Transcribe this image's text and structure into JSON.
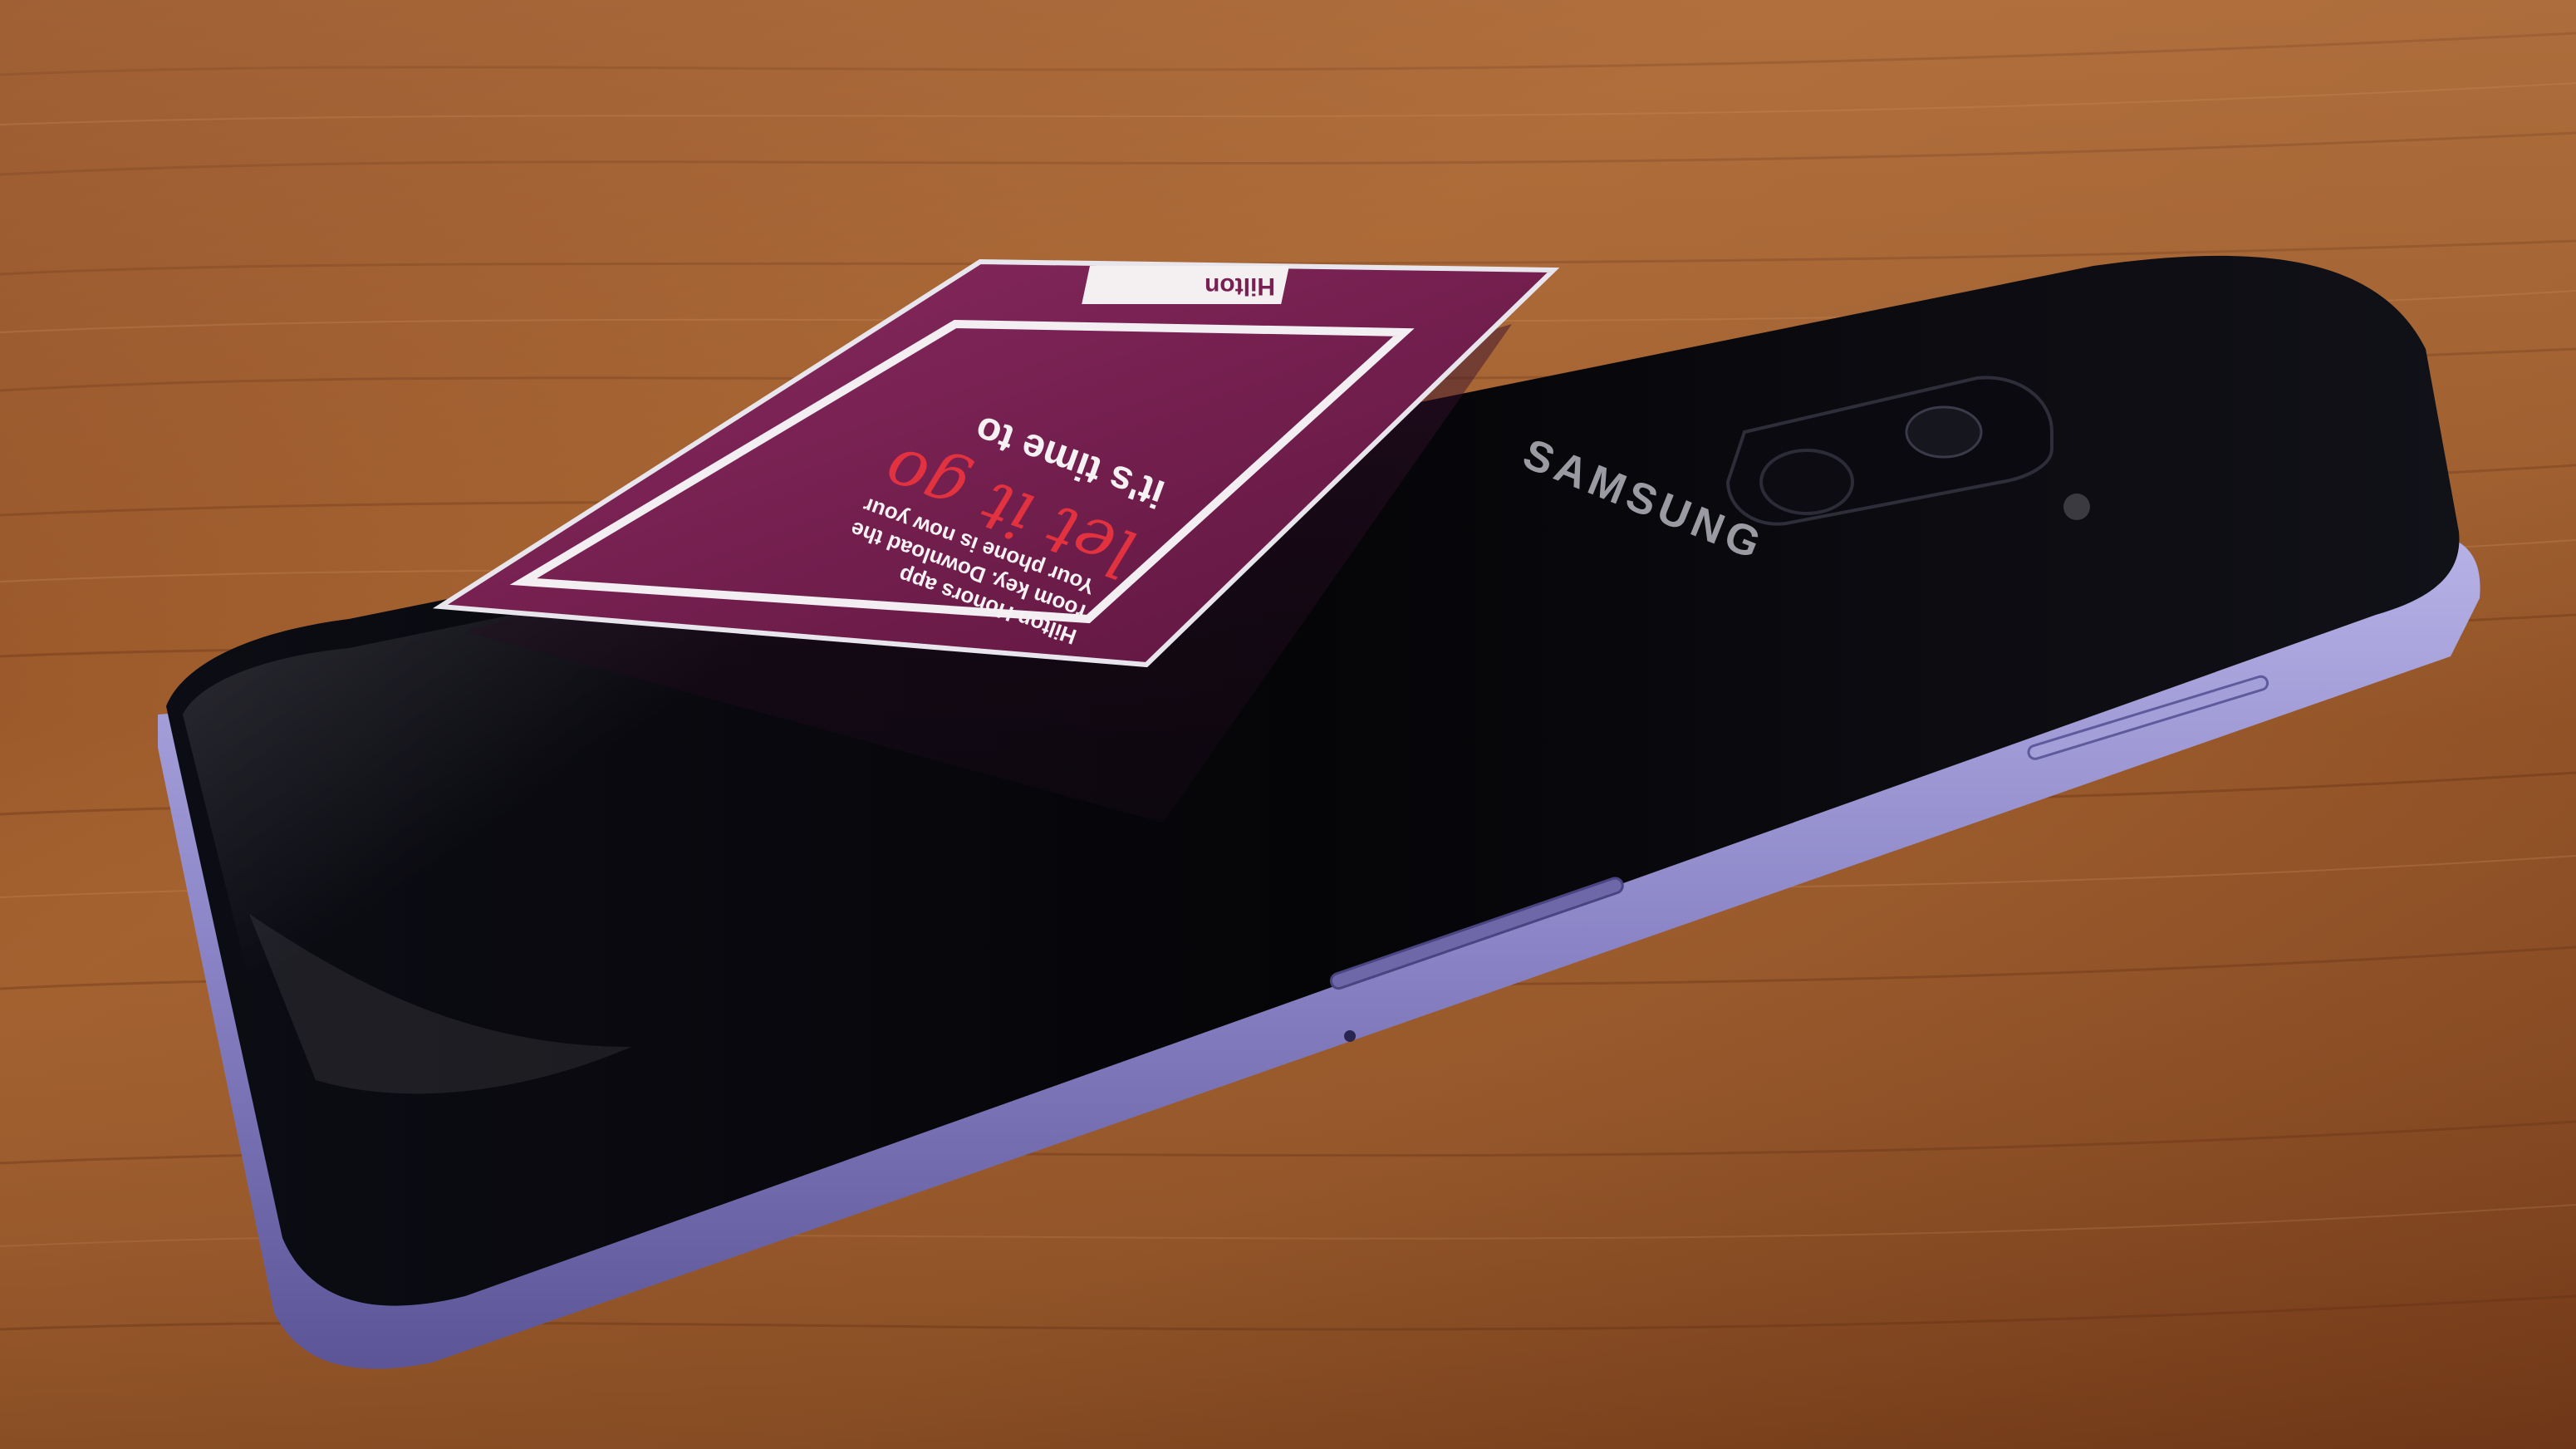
{
  "scene": {
    "kind": "photo",
    "description_keys": [
      "wood-table",
      "smartphone",
      "key-card"
    ]
  },
  "phone": {
    "brand": "SAMSUNG",
    "frame_color": "#8d86c9",
    "body_color": "#050508"
  },
  "card": {
    "headline": "it's time to",
    "script": "let it go",
    "body_line_1": "Your phone is now your",
    "body_line_2": "room key. Download the",
    "body_line_3": "Hilton Honors app",
    "logo": "Hilton",
    "card_color": "#7a1f52",
    "accent_color": "#e2313f"
  },
  "colors": {
    "wood_light": "#b06b3b",
    "wood_dark": "#5a2a12"
  }
}
